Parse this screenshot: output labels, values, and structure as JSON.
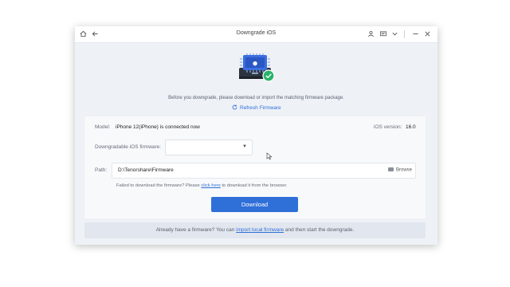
{
  "window": {
    "title": "Downgrade iOS"
  },
  "header": {
    "description": "Before you downgrade, please download or import the matching firmware package.",
    "refresh_label": "Refresh Firmware"
  },
  "device": {
    "model_label": "Model:",
    "model_value": "iPhone 12(iPhone) is connected now",
    "ios_label": "iOS version:",
    "ios_value": "16.0"
  },
  "firmware": {
    "label": "Downgradable iOS firmware:",
    "selected": ""
  },
  "path": {
    "label": "Path:",
    "value": "D:\\Tenorshare\\Firmware",
    "browse_label": "Browse"
  },
  "fail_message": {
    "prefix": "Failed to download the firmware? Please ",
    "link": "click here",
    "suffix": " to download it from the browser."
  },
  "download_button": "Download",
  "footer": {
    "prefix": "Already have a firmware? You can ",
    "link": "import local firmware",
    "suffix": " and then start the downgrade."
  },
  "colors": {
    "accent": "#2f6fd8",
    "success": "#29b36a"
  }
}
